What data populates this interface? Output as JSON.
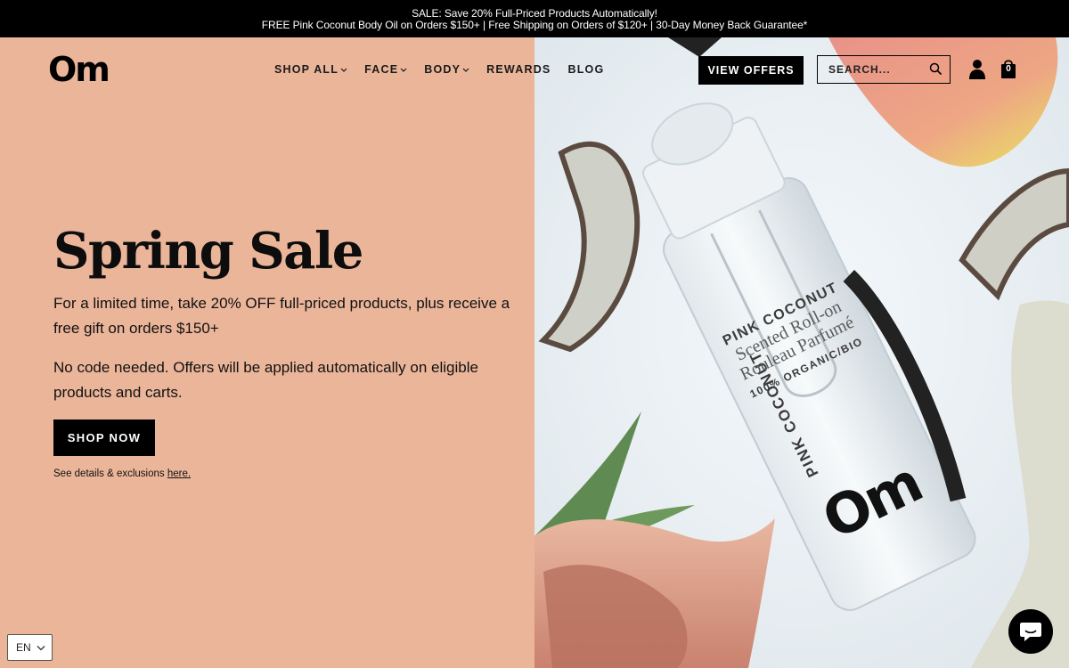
{
  "announcement": {
    "line1": "SALE: Save 20% Full-Priced Products Automatically!",
    "line2": "FREE Pink Coconut Body Oil on Orders $150+ | Free Shipping on Orders of $120+ | 30-Day Money Back Guarantee*"
  },
  "header": {
    "logo": "Om",
    "nav": [
      {
        "label": "SHOP ALL",
        "dropdown": true
      },
      {
        "label": "FACE",
        "dropdown": true
      },
      {
        "label": "BODY",
        "dropdown": true
      },
      {
        "label": "REWARDS",
        "dropdown": false
      },
      {
        "label": "BLOG",
        "dropdown": false
      }
    ],
    "offers_button": "VIEW OFFERS",
    "search_placeholder": "SEARCH...",
    "cart_count": "0"
  },
  "hero": {
    "title": "Spring Sale",
    "paragraph1": "For a limited time, take 20% OFF full-priced products, plus receive a free gift on orders $150+",
    "paragraph2": "No code needed. Offers will be applied automatically on eligible products and carts.",
    "cta": "SHOP NOW",
    "details_text": "See details & exclusions ",
    "details_link": "here.",
    "left_bg": "#ebb59a"
  },
  "product": {
    "line1": "PINK COCONUT",
    "line2": "Scented Roll-on",
    "line3": "Rouleau Parfumé",
    "line4": "100% ORGANIC/BIO",
    "brand": "Om"
  },
  "footer": {
    "language": "EN"
  },
  "icons": {
    "search": "search-icon",
    "account": "account-icon",
    "cart": "cart-icon",
    "chat": "chat-icon"
  }
}
